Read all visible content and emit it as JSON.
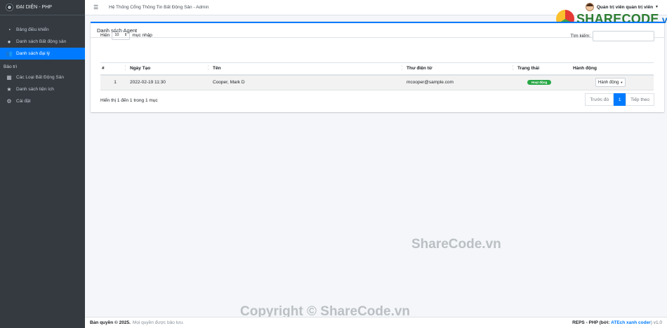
{
  "brand": {
    "name": "ĐẠI DIỆN - PHP"
  },
  "sidebar": {
    "items": [
      {
        "label": "Bảng điều khiển",
        "icon": "tachometer-icon"
      },
      {
        "label": "Danh sách Bất động sản",
        "icon": "map-marker-icon"
      },
      {
        "label": "Danh sách đại lý",
        "icon": "users-icon",
        "active": true
      }
    ],
    "maintenance_header": "Bảo trì",
    "maintenance_items": [
      {
        "label": "Các Loại Bất Động Sản",
        "icon": "table-icon"
      },
      {
        "label": "Danh sách tiện ích",
        "icon": "star-icon"
      },
      {
        "label": "Cài đặt",
        "icon": "cogs-icon"
      }
    ]
  },
  "topbar": {
    "title": "Hệ Thống Cổng Thông Tin Bất Động Sản - Admin",
    "user": "Quản trị viên quản trị viên"
  },
  "watermark": {
    "logo_main": "SHARECODE",
    "logo_suffix": ".vn",
    "center": "ShareCode.vn",
    "copyright": "Copyright © ShareCode.vn"
  },
  "card": {
    "title": "Danh sách Agent",
    "length_prefix": "Hiện",
    "length_value": "10",
    "length_suffix": "mục nhập",
    "search_label": "Tìm kiếm:",
    "columns": [
      "#",
      "Ngày Tạo",
      "Tên",
      "Thư điện tử",
      "Trạng thái",
      "Hành động"
    ],
    "rows": [
      {
        "index": "1",
        "created": "2022-02-19 11:30",
        "name": "Cooper, Mark D",
        "email": "mcooper@sample.com",
        "status": "Hoạt động",
        "action": "Hành động"
      }
    ],
    "info": "Hiển thị 1 đến 1 trong 1 mục",
    "pager": {
      "prev": "Trước đó",
      "current": "1",
      "next": "Tiếp theo"
    }
  },
  "footer": {
    "copyright_label": "Bản quyền © 2025.",
    "rights": "Mọi quyền được bảo lưu.",
    "credit_prefix": "REPS - PHP (bởi:",
    "credit_author": "ATEch xanh coder",
    "credit_suffix": ") v1.0"
  },
  "colors": {
    "primary": "#007bff",
    "sidebar": "#343a40",
    "success": "#28a745"
  }
}
